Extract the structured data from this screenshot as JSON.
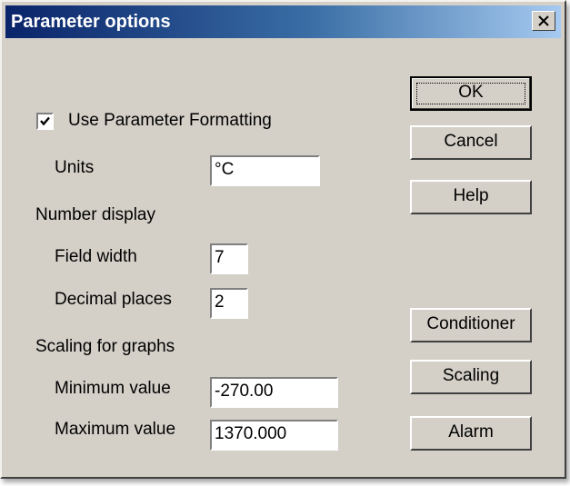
{
  "window": {
    "title": "Parameter options",
    "close_glyph": "×"
  },
  "format": {
    "checkbox_label": "Use Parameter Formatting",
    "checked": true,
    "units_label": "Units",
    "units_value": "°C"
  },
  "number_display": {
    "heading": "Number display",
    "field_width_label": "Field width",
    "field_width_value": "7",
    "decimal_places_label": "Decimal places",
    "decimal_places_value": "2"
  },
  "scaling": {
    "heading": "Scaling for graphs",
    "min_label": "Minimum value",
    "min_value": "-270.00",
    "max_label": "Maximum value",
    "max_value": "1370.000"
  },
  "buttons": {
    "ok": "OK",
    "cancel": "Cancel",
    "help": "Help",
    "conditioner": "Conditioner",
    "scaling": "Scaling",
    "alarm": "Alarm"
  }
}
